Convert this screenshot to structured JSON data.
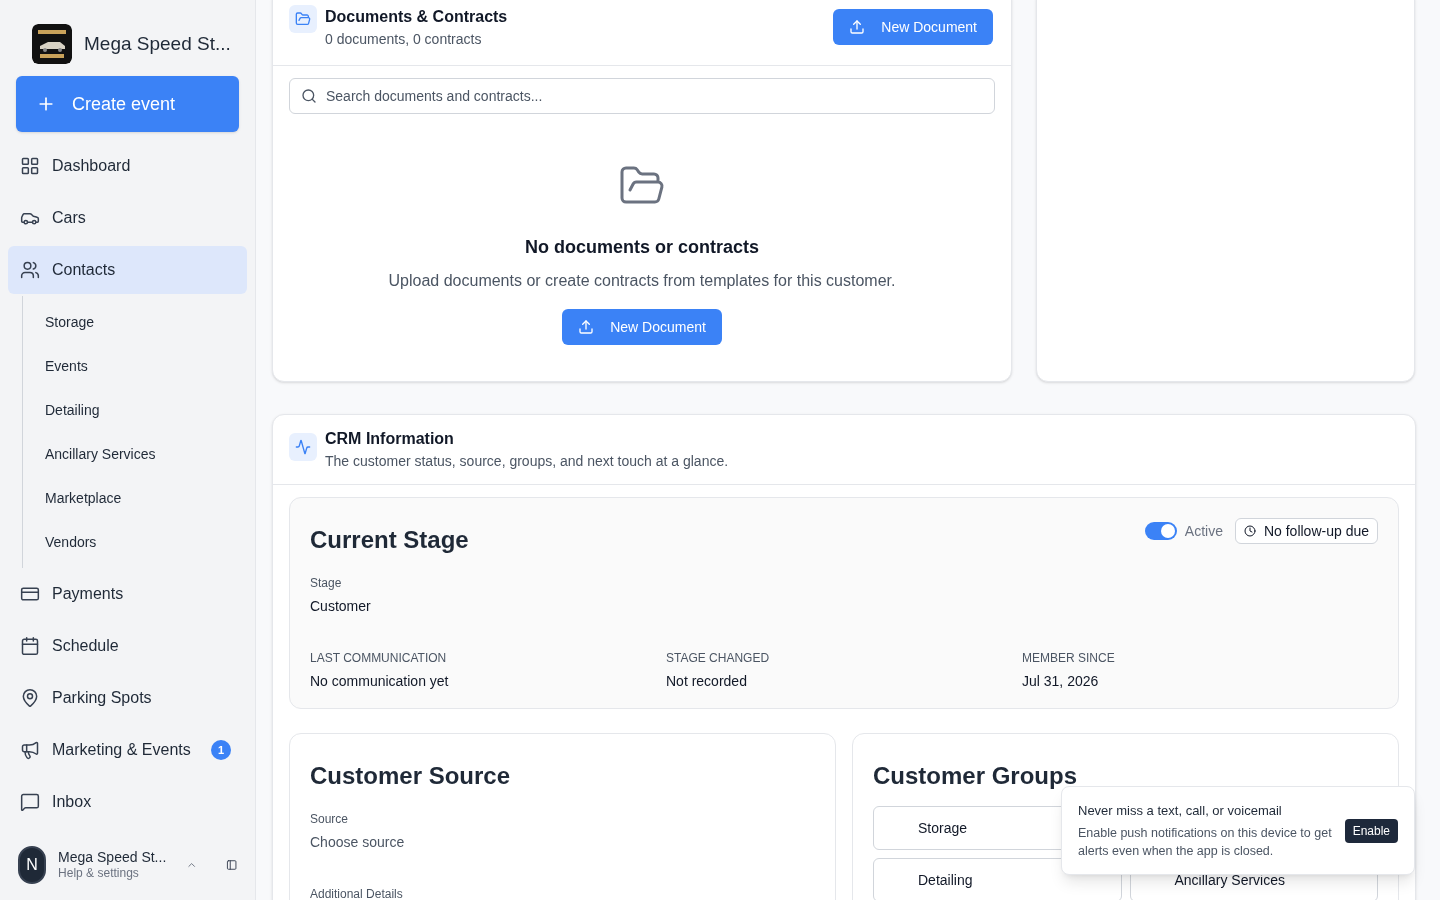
{
  "sidebar": {
    "brand": "Mega Speed St...",
    "create_button": "Create event",
    "items": [
      {
        "label": "Dashboard",
        "selected": false
      },
      {
        "label": "Cars",
        "selected": false
      },
      {
        "label": "Contacts",
        "selected": true,
        "children": [
          {
            "label": "Storage"
          },
          {
            "label": "Events"
          },
          {
            "label": "Detailing"
          },
          {
            "label": "Ancillary Services"
          },
          {
            "label": "Marketplace"
          },
          {
            "label": "Vendors"
          }
        ]
      },
      {
        "label": "Payments",
        "selected": false
      },
      {
        "label": "Schedule",
        "selected": false
      },
      {
        "label": "Parking Spots",
        "selected": false
      },
      {
        "label": "Marketing & Events",
        "selected": false,
        "badge": "1"
      },
      {
        "label": "Inbox",
        "selected": false
      }
    ],
    "user": {
      "avatar": "N",
      "name": "Mega Speed St...",
      "subtitle": "Help & settings"
    }
  },
  "documents": {
    "title": "Documents & Contracts",
    "subtitle": "0 documents, 0 contracts",
    "button": "New Document",
    "search_placeholder": "Search documents and contracts...",
    "empty_title": "No documents or contracts",
    "empty_text": "Upload documents or create contracts from templates for this customer.",
    "empty_button": "New Document"
  },
  "crm": {
    "title": "CRM Information",
    "subtitle": "The customer status, source, groups, and next touch at a glance.",
    "stage": {
      "title": "Current Stage",
      "active_label": "Active",
      "active": true,
      "follow_up": "No follow-up due",
      "stage_label": "Stage",
      "stage_value": "Customer",
      "facts": [
        {
          "label": "LAST COMMUNICATION",
          "value": "No communication yet"
        },
        {
          "label": "STAGE CHANGED",
          "value": "Not recorded"
        },
        {
          "label": "MEMBER SINCE",
          "value": "Jul 31, 2026"
        }
      ]
    },
    "source": {
      "title": "Customer Source",
      "source_label": "Source",
      "source_value": "Choose source",
      "details_label": "Additional Details"
    },
    "groups": {
      "title": "Customer Groups",
      "items": [
        {
          "label": "Storage"
        },
        {
          "label": "Detailing"
        },
        {
          "label": "Ancillary Services"
        }
      ]
    }
  },
  "toast": {
    "title": "Never miss a text, call, or voicemail",
    "text": "Enable push notifications on this device to get alerts even when the app is closed.",
    "button": "Enable"
  }
}
